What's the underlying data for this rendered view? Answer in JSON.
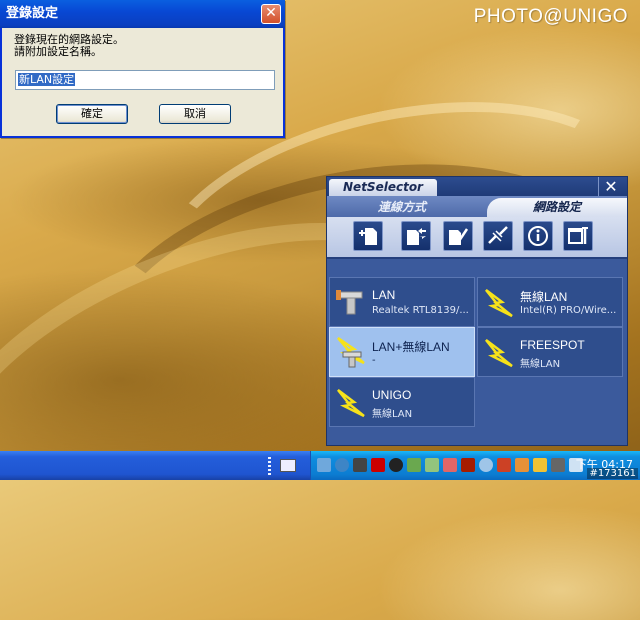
{
  "desktop": {
    "watermark": "PHOTO@UNIGO",
    "image_stamp": "#173161"
  },
  "dialog": {
    "title": "登錄設定",
    "close_glyph": "✕",
    "message_line1": "登錄現在的網路設定。",
    "message_line2": "請附加設定名稱。",
    "input_value": "新LAN設定",
    "ok_label": "確定",
    "cancel_label": "取消"
  },
  "netselector": {
    "title": "NetSelector",
    "close_glyph": "✕",
    "tabs": [
      {
        "label": "連線方式",
        "selected": false
      },
      {
        "label": "網路設定",
        "selected": true
      }
    ],
    "toolbar": [
      {
        "icon": "add-setting-icon"
      },
      {
        "icon": "transfer-icon"
      },
      {
        "icon": "edit-icon"
      },
      {
        "icon": "disconnect-icon"
      },
      {
        "icon": "info-icon"
      },
      {
        "icon": "tools-icon"
      }
    ],
    "profiles": [
      {
        "name": "LAN",
        "sub": "Realtek RTL8139/...",
        "icon": "lan-connector-icon",
        "active": false
      },
      {
        "name": "無線LAN",
        "sub": "Intel(R) PRO/Wire...",
        "icon": "wireless-lightning-icon",
        "active": false
      },
      {
        "name": "LAN+無線LAN",
        "sub": "-",
        "icon": "lan-wireless-icon",
        "active": true
      },
      {
        "name": "FREESPOT",
        "sub": "無線LAN",
        "icon": "wireless-lightning-icon",
        "active": false
      },
      {
        "name": "UNIGO",
        "sub": "無線LAN",
        "icon": "wireless-lightning-icon",
        "active": false
      }
    ],
    "colors": {
      "panel": "#3b5a9c",
      "tile": "#2f4e8d",
      "tile_active": "#9fc1ee",
      "lightning": "#f6e21a"
    }
  },
  "taskbar": {
    "clock": "下午 04:17",
    "tray_icons": [
      "network-icon",
      "globe-icon",
      "printer-icon",
      "off-icon",
      "eco-icon",
      "shield-icon",
      "pen-icon",
      "firewall-icon",
      "sync-icon",
      "power-icon",
      "security-icon",
      "flag-icon",
      "brush-icon",
      "monitor-icon",
      "volume-icon"
    ]
  }
}
